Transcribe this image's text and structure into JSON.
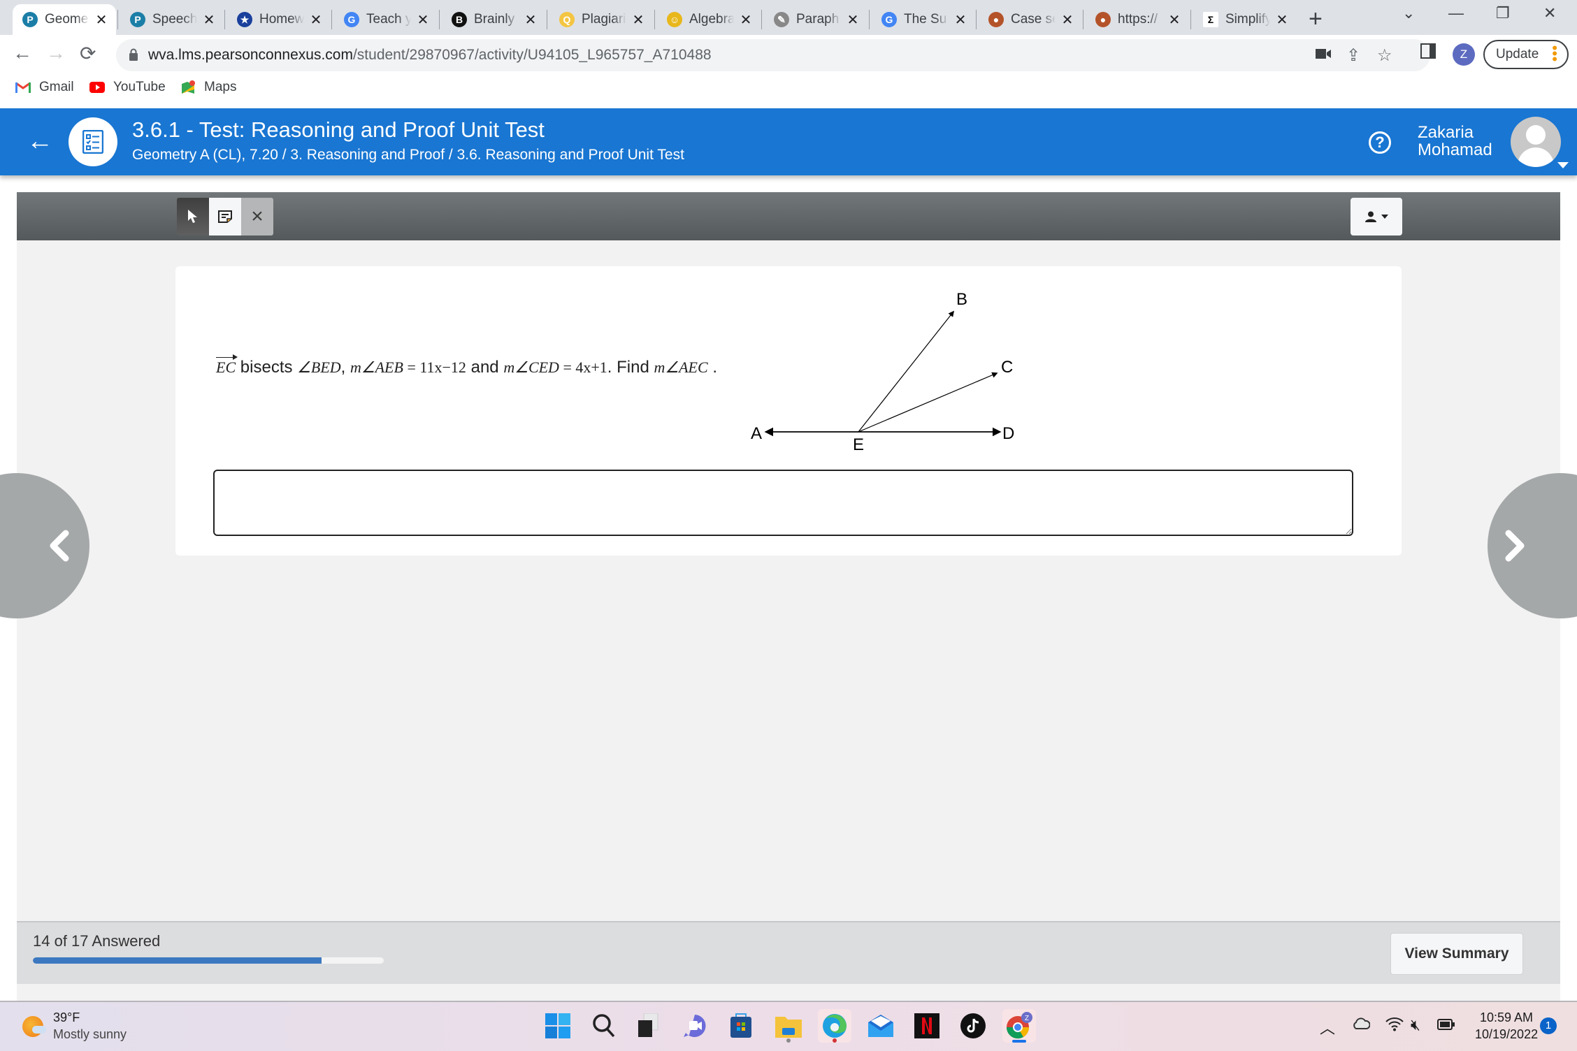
{
  "browser": {
    "tabs": [
      {
        "title": "Geometry",
        "icon": "pearson-icon",
        "color": "#1b7ea6",
        "glyph": "P",
        "active": true
      },
      {
        "title": "Speech",
        "icon": "pearson-icon",
        "color": "#1b7ea6",
        "glyph": "P",
        "active": false
      },
      {
        "title": "Homework",
        "icon": "shield-star-icon",
        "color": "#1a3f9c",
        "glyph": "★",
        "active": false
      },
      {
        "title": "Teach y",
        "icon": "google-icon",
        "color": "#4285f4",
        "glyph": "G",
        "active": false
      },
      {
        "title": "Brainly",
        "icon": "brainly-icon",
        "color": "#111111",
        "glyph": "B",
        "active": false
      },
      {
        "title": "Plagiari",
        "icon": "magnifier-icon",
        "color": "#f4c542",
        "glyph": "Q",
        "active": false
      },
      {
        "title": "Algebra",
        "icon": "algebra-face-icon",
        "color": "#e8b71a",
        "glyph": "☺",
        "active": false
      },
      {
        "title": "Paraph",
        "icon": "quill-icon",
        "color": "#888888",
        "glyph": "✎",
        "active": false
      },
      {
        "title": "The Su",
        "icon": "google-icon",
        "color": "#4285f4",
        "glyph": "G",
        "active": false
      },
      {
        "title": "Case se",
        "icon": "emblem-icon",
        "color": "#b4532a",
        "glyph": "●",
        "active": false
      },
      {
        "title": "https://",
        "icon": "emblem-icon",
        "color": "#b4532a",
        "glyph": "●",
        "active": false
      },
      {
        "title": "Simplify",
        "icon": "sigma-icon",
        "color": "#ffffff",
        "glyph": "Σ",
        "active": false
      }
    ],
    "tab_close_glyph": "✕",
    "new_tab_glyph": "+",
    "url_host": "wva.lms.pearsonconnexus.com",
    "url_path": "/student/29870967/activity/U94105_L965757_A710488",
    "profile_initial": "Z",
    "update_label": "Update",
    "bookmarks": [
      {
        "label": "Gmail",
        "icon": "gmail-icon"
      },
      {
        "label": "YouTube",
        "icon": "youtube-icon"
      },
      {
        "label": "Maps",
        "icon": "maps-icon"
      }
    ]
  },
  "header": {
    "title": "3.6.1 - Test: Reasoning and Proof Unit Test",
    "breadcrumb": "Geometry A (CL), 7.20 / 3. Reasoning and Proof / 3.6. Reasoning and Proof Unit Test",
    "help_glyph": "?",
    "user_first": "Zakaria",
    "user_last": "Mohamad"
  },
  "question": {
    "ray_name": "EC",
    "t1": " bisects ",
    "angle_bed": "∠BED",
    "comma": ", ",
    "expr1_m": "m∠AEB",
    "expr1_eq": " = 11x−12",
    "and": " and ",
    "expr2_m": "m∠CED",
    "expr2_eq": " = 4x+1",
    "find": ". Find ",
    "target": "m∠AEC",
    "period": " .",
    "answer_value": "",
    "diagram": {
      "labels": [
        "A",
        "B",
        "C",
        "D",
        "E"
      ],
      "rays": [
        "EA",
        "EB",
        "EC",
        "ED"
      ]
    }
  },
  "footer": {
    "answered_label": "14 of 17 Answered",
    "answered": 14,
    "total": 17,
    "view_summary_label": "View Summary",
    "progress_color": "#3b78c0"
  },
  "taskbar": {
    "temperature": "39°F",
    "condition": "Mostly sunny",
    "apps": [
      "windows-start",
      "search",
      "task-view",
      "teams-chat",
      "microsoft-store",
      "file-explorer",
      "edge",
      "mail",
      "netflix",
      "tiktok",
      "chrome"
    ],
    "time": "10:59 AM",
    "date": "10/19/2022",
    "notification_count": "1"
  }
}
